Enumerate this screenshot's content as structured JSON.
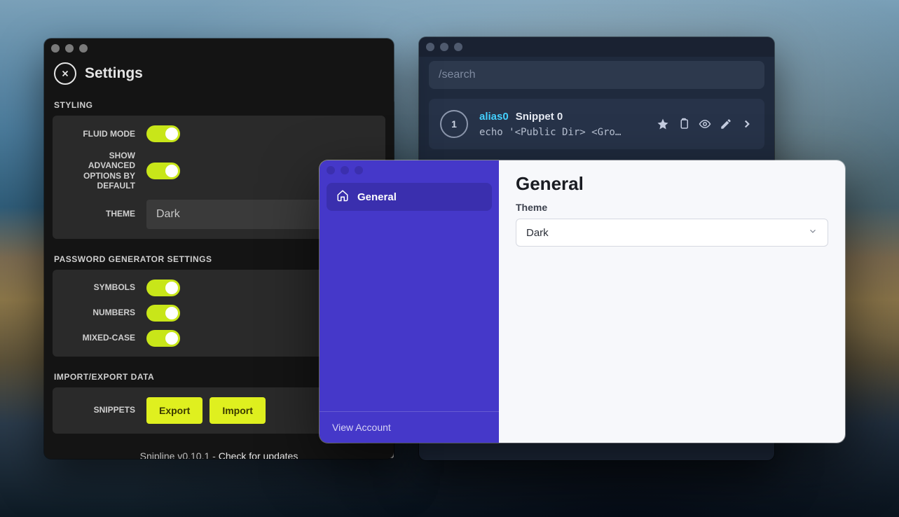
{
  "settings": {
    "title": "Settings",
    "sections": {
      "styling": {
        "heading": "STYLING",
        "fluid_mode_label": "FLUID MODE",
        "advanced_label": "SHOW ADVANCED OPTIONS BY DEFAULT",
        "theme_label": "THEME",
        "theme_value": "Dark"
      },
      "pwgen": {
        "heading": "PASSWORD GENERATOR SETTINGS",
        "symbols_label": "SYMBOLS",
        "numbers_label": "NUMBERS",
        "mixed_label": "MIXED-CASE"
      },
      "io": {
        "heading": "IMPORT/EXPORT DATA",
        "snippets_label": "SNIPPETS",
        "export_label": "Export",
        "import_label": "Import"
      }
    },
    "footer": {
      "version_text": "Snipline v0.10.1 - ",
      "update_link": "Check for updates"
    }
  },
  "snip": {
    "search_placeholder": "/search",
    "card": {
      "number": "1",
      "alias": "alias0",
      "name": "Snippet 0",
      "code": "echo '<Public Dir> <Gro…"
    }
  },
  "modal": {
    "side_item": "General",
    "view_account": "View Account",
    "heading": "General",
    "theme_label": "Theme",
    "theme_value": "Dark"
  }
}
